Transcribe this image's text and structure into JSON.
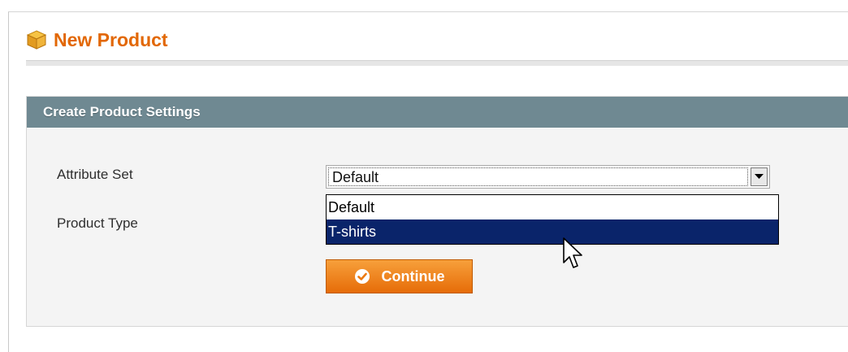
{
  "header": {
    "title": "New Product",
    "icon": "product-box-icon"
  },
  "section": {
    "title": "Create Product Settings"
  },
  "form": {
    "attribute_set": {
      "label": "Attribute Set",
      "selected": "Default",
      "options": [
        "Default",
        "T-shirts"
      ],
      "highlighted": "T-shirts"
    },
    "product_type": {
      "label": "Product Type"
    }
  },
  "actions": {
    "continue_label": "Continue"
  },
  "colors": {
    "title": "#e26703",
    "section_header": "#6f8992",
    "button": "#f08c24",
    "selection": "#0a246a"
  }
}
